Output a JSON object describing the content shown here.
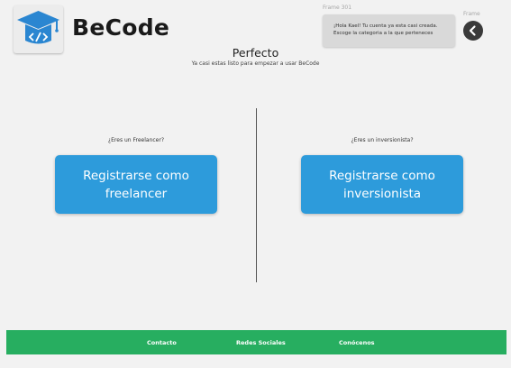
{
  "header": {
    "brand_name": "BeCode",
    "frame_label_left": "Frame 301",
    "frame_label_right": "Frame",
    "notification": {
      "line1": "¡Hola Kael! Tu cuenta ya esta casi creada.",
      "line2": "Escoge la categoria a la que perteneces"
    }
  },
  "main": {
    "title": "Perfecto",
    "subtitle": "Ya casi estas listo para empezar a usar BeCode",
    "freelancer": {
      "question": "¿Eres un Freelancer?",
      "button_line1": "Registrarse como",
      "button_line2": "freelancer"
    },
    "investor": {
      "question": "¿Eres un inversionista?",
      "button_line1": "Registrarse como",
      "button_line2": "inversionista"
    }
  },
  "footer": {
    "links": [
      "Contacto",
      "Redes Sociales",
      "Conócenos"
    ]
  },
  "colors": {
    "primary_button": "#2d9bdb",
    "footer": "#27ae60",
    "logo_icon": "#2a86d1",
    "back_button": "#3a3a3a"
  },
  "icons": {
    "logo": "graduation-cap-code-icon",
    "back": "chevron-left-icon"
  }
}
